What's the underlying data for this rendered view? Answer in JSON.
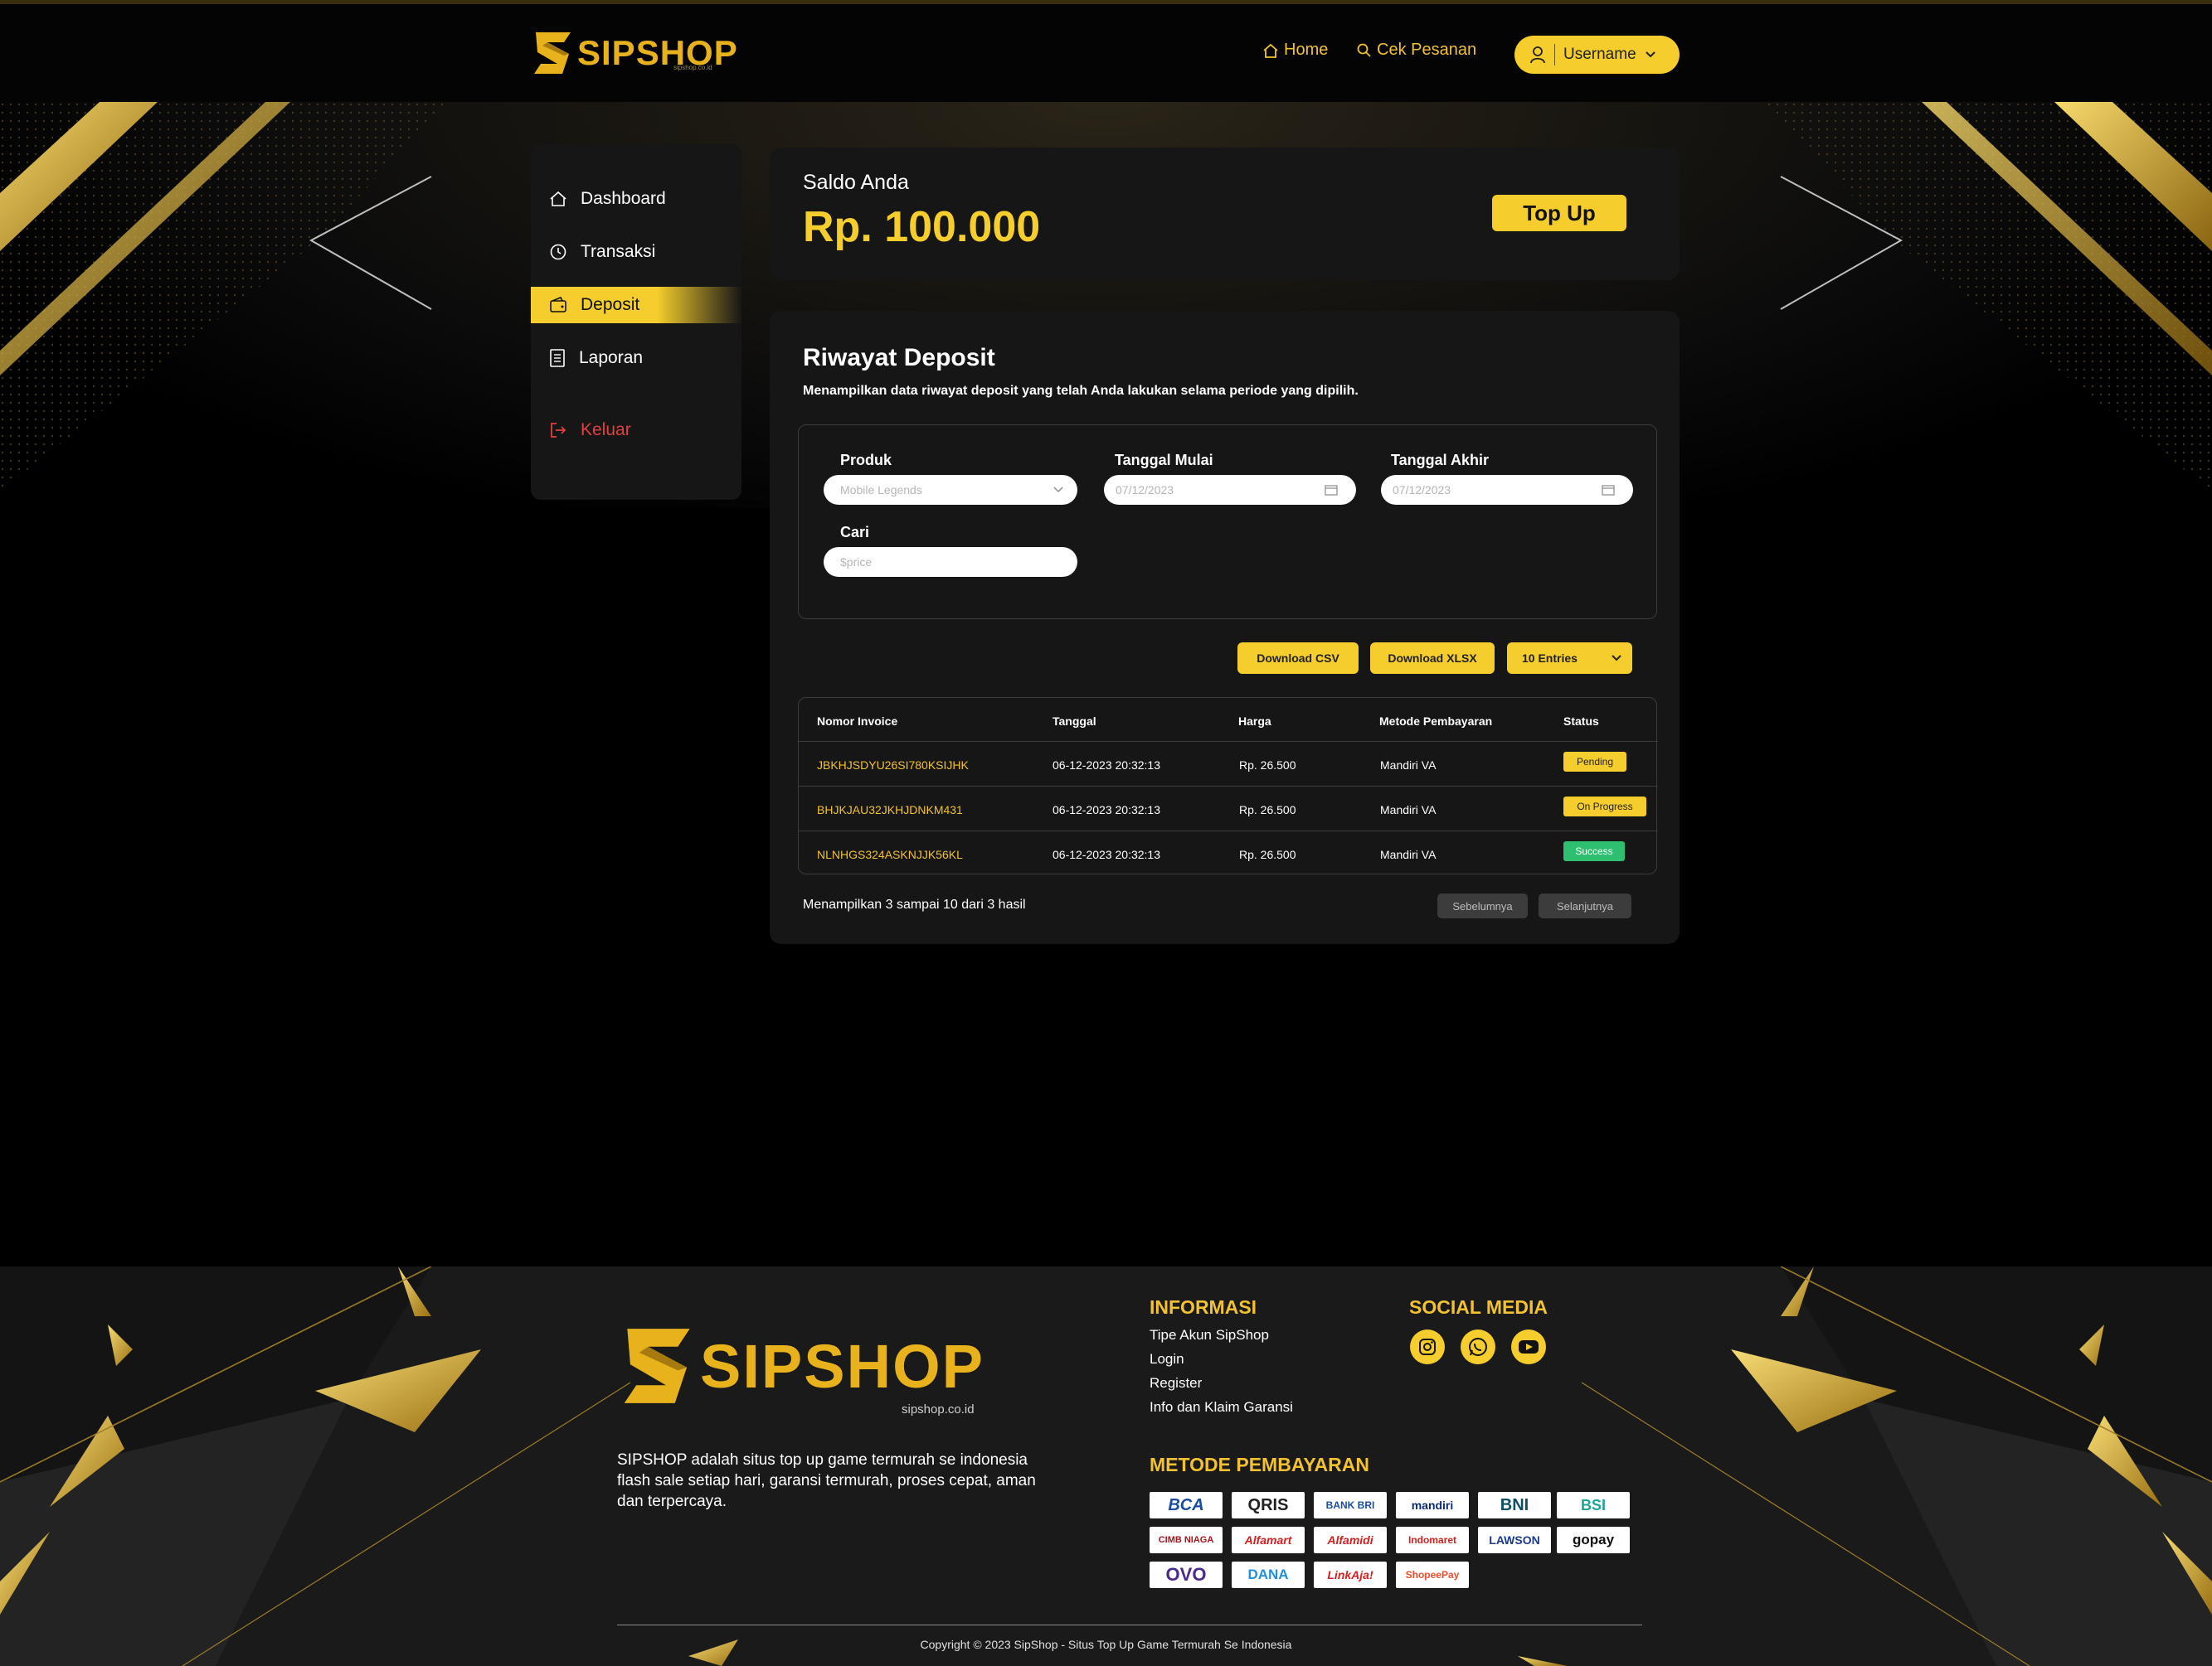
{
  "brand": {
    "name": "SIPSHOP",
    "domain": "sipshop.co.id",
    "accent": "#f5cd2c"
  },
  "nav": {
    "home": "Home",
    "check_order": "Cek Pesanan",
    "user": "Username"
  },
  "sidebar": {
    "items": [
      {
        "label": "Dashboard",
        "icon": "home-icon"
      },
      {
        "label": "Transaksi",
        "icon": "history-icon"
      },
      {
        "label": "Deposit",
        "icon": "wallet-icon",
        "active": true
      },
      {
        "label": "Laporan",
        "icon": "report-icon"
      }
    ],
    "logout": "Keluar"
  },
  "balance": {
    "label": "Saldo Anda",
    "amount": "Rp. 100.000",
    "topup": "Top Up"
  },
  "deposit": {
    "title": "Riwayat Deposit",
    "subtitle": "Menampilkan data riwayat deposit yang telah Anda lakukan selama periode yang dipilih.",
    "filters": {
      "product_label": "Produk",
      "product_value": "Mobile Legends",
      "start_label": "Tanggal Mulai",
      "start_value": "07/12/2023",
      "end_label": "Tanggal Akhir",
      "end_value": "07/12/2023",
      "search_label": "Cari",
      "search_placeholder": "$price"
    },
    "actions": {
      "csv": "Download CSV",
      "xlsx": "Download XLSX",
      "entries": "10 Entries"
    },
    "columns": [
      "Nomor Invoice",
      "Tanggal",
      "Harga",
      "Metode Pembayaran",
      "Status"
    ],
    "rows": [
      {
        "invoice": "JBKHJSDYU26SI780KSIJHK",
        "date": "06-12-2023 20:32:13",
        "price": "Rp. 26.500",
        "method": "Mandiri VA",
        "status": "Pending",
        "status_color": "#f5cd2c"
      },
      {
        "invoice": "BHJKJAU32JKHJDNKM431",
        "date": "06-12-2023 20:32:13",
        "price": "Rp. 26.500",
        "method": "Mandiri VA",
        "status": "On Progress",
        "status_color": "#f5cd2c"
      },
      {
        "invoice": "NLNHGS324ASKNJJK56KL",
        "date": "06-12-2023 20:32:13",
        "price": "Rp. 26.500",
        "method": "Mandiri VA",
        "status": "Success",
        "status_color": "#2fbf71"
      }
    ],
    "summary": "Menampilkan 3 sampai 10 dari 3 hasil",
    "prev": "Sebelumnya",
    "next": "Selanjutnya"
  },
  "footer": {
    "about": "SIPSHOP adalah situs top up game termurah se indonesia flash sale setiap hari, garansi termurah, proses cepat, aman dan terpercaya.",
    "info_title": "INFORMASI",
    "info_links": [
      "Tipe Akun SipShop",
      "Login",
      "Register",
      "Info dan Klaim Garansi"
    ],
    "social_title": "SOCIAL MEDIA",
    "social": [
      "instagram-icon",
      "whatsapp-icon",
      "youtube-icon"
    ],
    "payment_title": "METODE PEMBAYARAN",
    "payments": [
      "BCA",
      "QRIS",
      "BANK BRI",
      "mandiri",
      "BNI",
      "BSI",
      "CIMB NIAGA",
      "Alfamart",
      "Alfamidi",
      "Indomaret",
      "LAWSON",
      "gopay",
      "OVO",
      "DANA",
      "LinkAja!",
      "ShopeePay"
    ],
    "copyright": "Copyright © 2023 SipShop - Situs Top Up Game Termurah Se Indonesia"
  }
}
